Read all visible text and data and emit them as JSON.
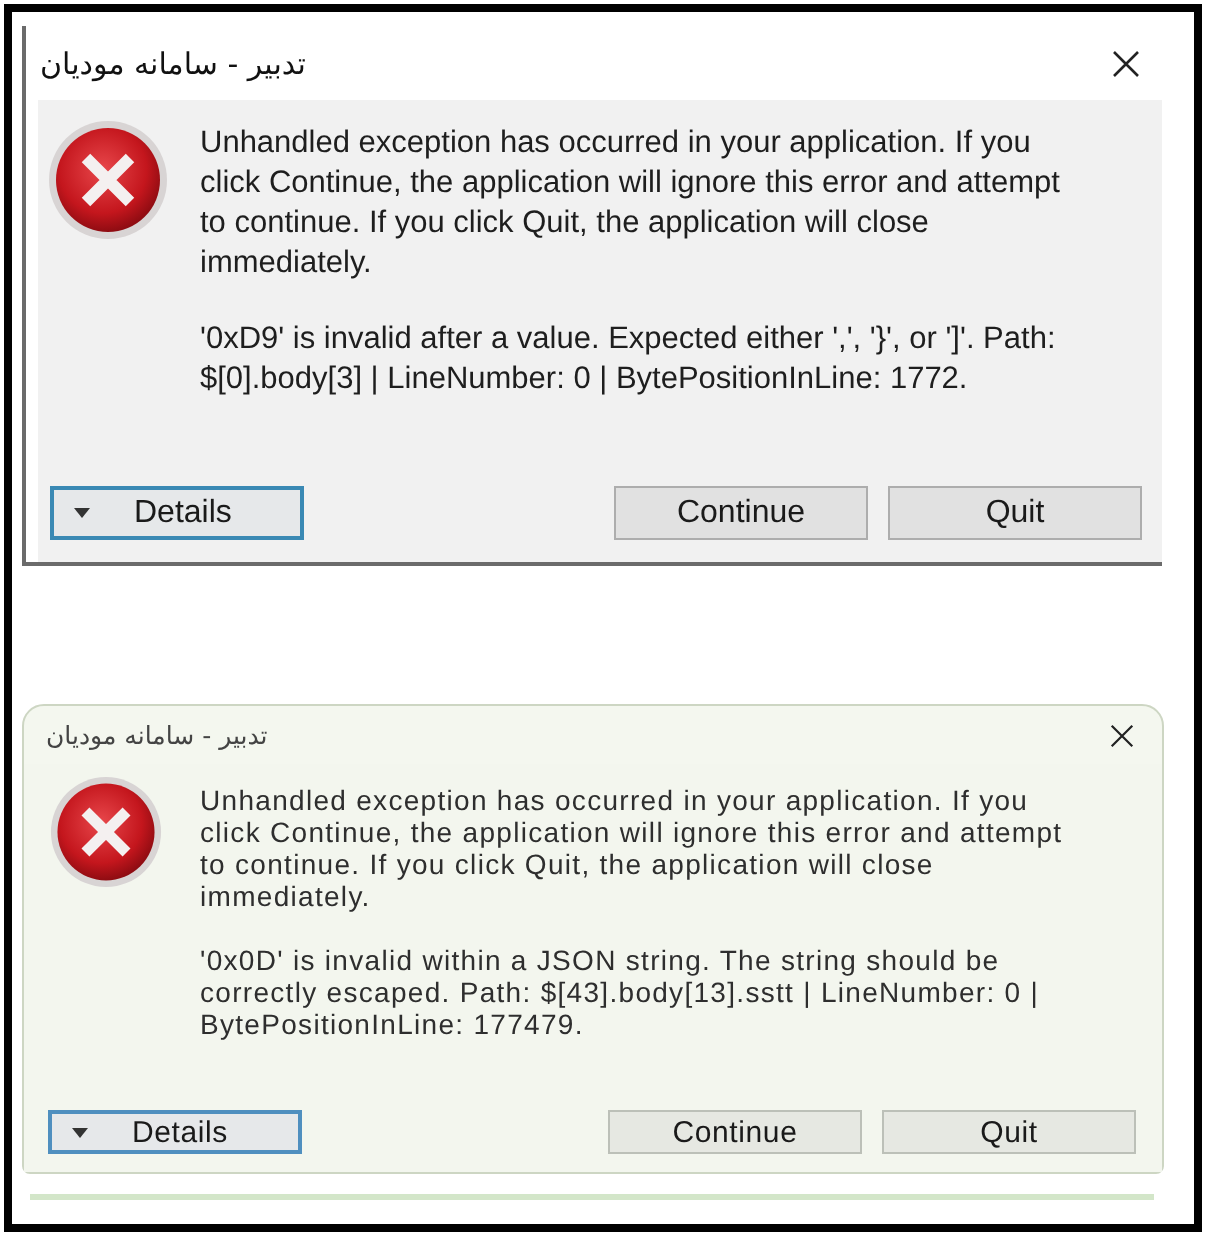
{
  "dialogs": [
    {
      "title": "تدبیر - سامانه مودیان",
      "message": "Unhandled exception has occurred in your application. If you click Continue, the application will ignore this error and attempt to continue. If you click Quit, the application will close immediately.",
      "error": "'0xD9' is invalid after a value. Expected either ',', '}', or ']'. Path: $[0].body[3] | LineNumber: 0 | BytePositionInLine: 1772.",
      "buttons": [
        {
          "label": "Details",
          "kind": "details",
          "focused": true
        },
        {
          "label": "Continue",
          "kind": "action",
          "focused": false
        },
        {
          "label": "Quit",
          "kind": "action",
          "focused": false
        }
      ]
    },
    {
      "title": "تدبیر - سامانه مودیان",
      "message": "Unhandled exception has occurred in your application. If you click Continue, the application will ignore this error and attempt to continue. If you click Quit, the application will close immediately.",
      "error": "'0x0D' is invalid within a JSON string. The string should be correctly escaped. Path: $[43].body[13].sstt | LineNumber: 0 | BytePositionInLine: 177479.",
      "buttons": [
        {
          "label": "Details",
          "kind": "details",
          "focused": true
        },
        {
          "label": "Continue",
          "kind": "action",
          "focused": false
        },
        {
          "label": "Quit",
          "kind": "action",
          "focused": false
        }
      ]
    }
  ]
}
